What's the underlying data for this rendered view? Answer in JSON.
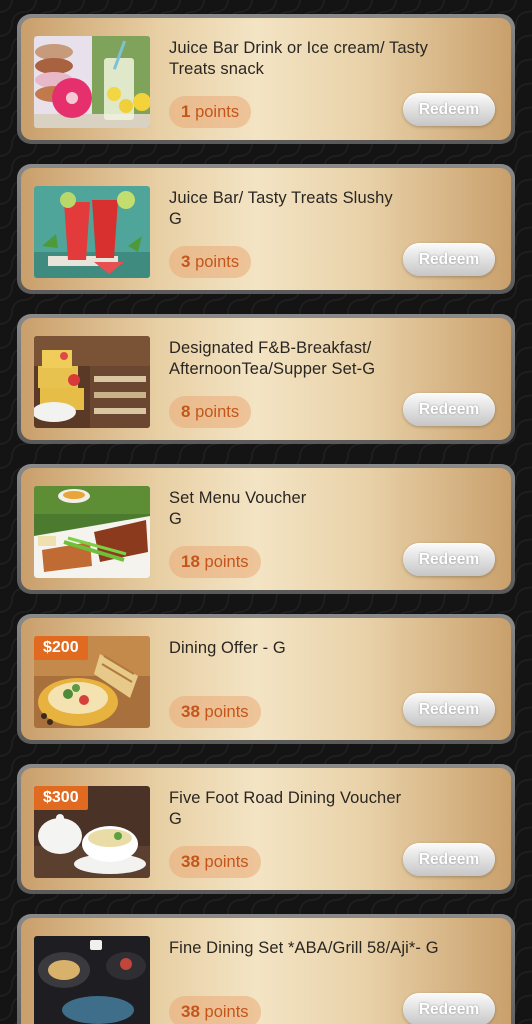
{
  "rewards": [
    {
      "title": "Juice Bar Drink or Ice cream/ Tasty\nTreats snack",
      "points_value": "1",
      "points_unit": "points",
      "redeem_label": "Redeem",
      "image": "donuts-and-lemonade-photo",
      "price_tag": ""
    },
    {
      "title": "Juice Bar/ Tasty Treats Slushy\nG",
      "points_value": "3",
      "points_unit": "points",
      "redeem_label": "Redeem",
      "image": "red-slushy-drinks-photo",
      "price_tag": ""
    },
    {
      "title": "Designated F&B-Breakfast/\nAfternoonTea/Supper Set-G",
      "points_value": "8",
      "points_unit": "points",
      "redeem_label": "Redeem",
      "image": "afternoon-tea-buffet-photo",
      "price_tag": ""
    },
    {
      "title": "Set Menu Voucher\nG",
      "points_value": "18",
      "points_unit": "points",
      "redeem_label": "Redeem",
      "image": "roast-duck-platter-photo",
      "price_tag": ""
    },
    {
      "title": "Dining Offer - G",
      "points_value": "38",
      "points_unit": "points",
      "redeem_label": "Redeem",
      "image": "bread-and-salad-bowl-photo",
      "price_tag": "$200"
    },
    {
      "title": "Five Foot Road Dining Voucher\nG",
      "points_value": "38",
      "points_unit": "points",
      "redeem_label": "Redeem",
      "image": "soup-tureen-photo",
      "price_tag": "$300"
    },
    {
      "title": "Fine Dining Set *ABA/Grill 58/Aji*- G",
      "points_value": "38",
      "points_unit": "points",
      "redeem_label": "Redeem",
      "image": "fine-dining-plates-photo",
      "price_tag": ""
    }
  ]
}
